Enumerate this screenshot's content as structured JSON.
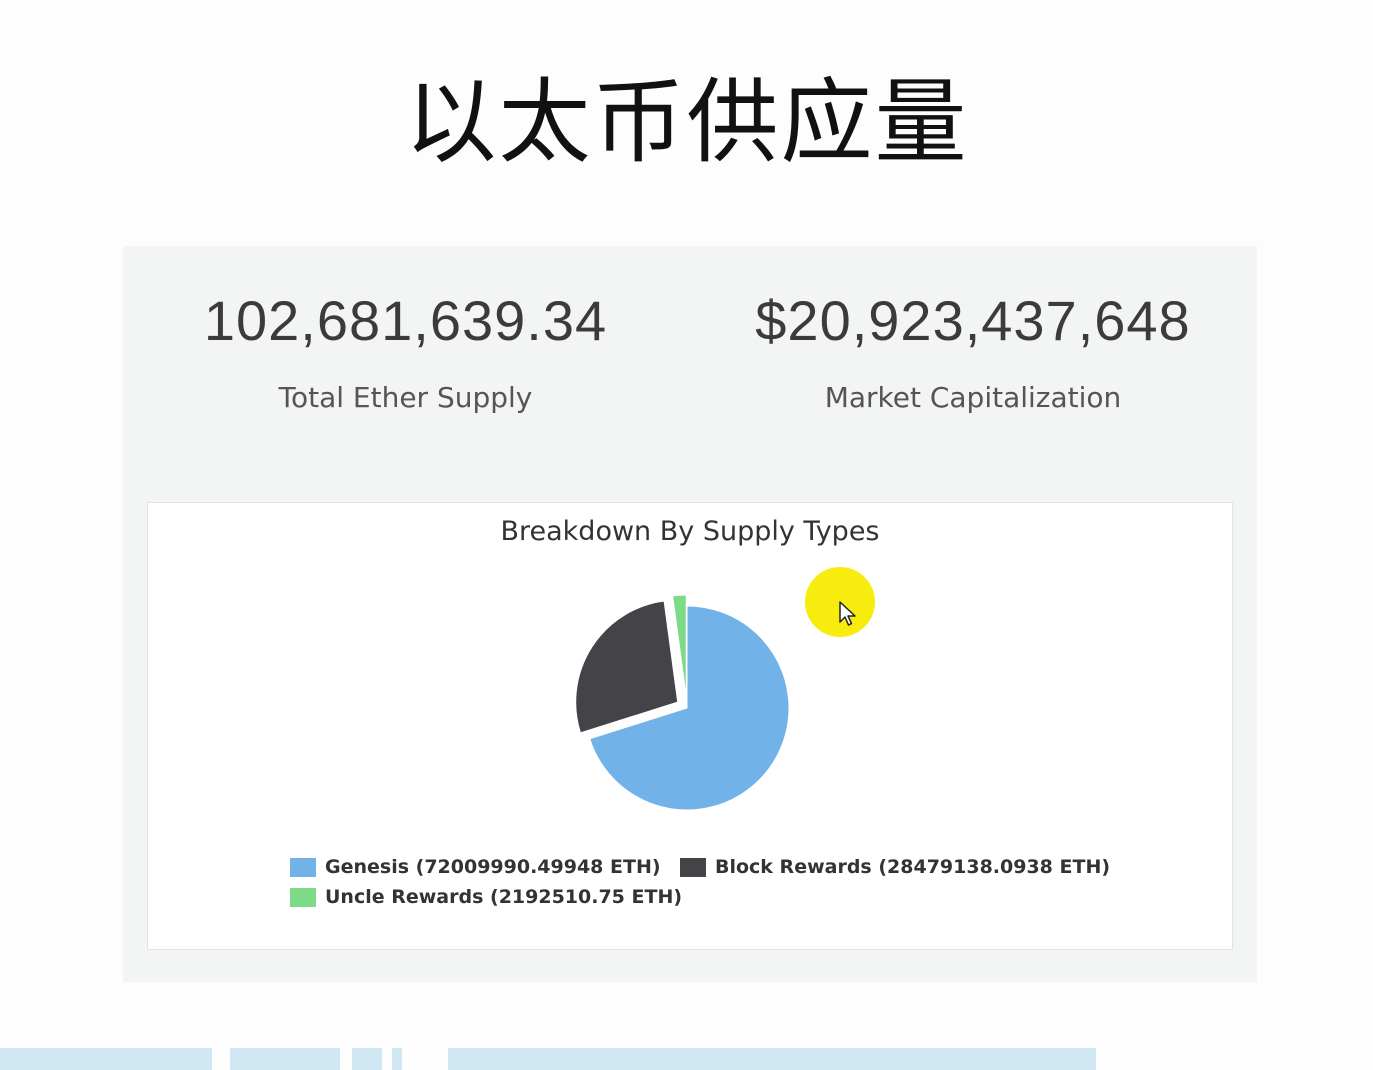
{
  "slide": {
    "title": "以太币供应量"
  },
  "stats": {
    "total_supply": {
      "value": "102,681,639.34",
      "label": "Total Ether Supply"
    },
    "market_cap": {
      "value": "$20,923,437,648",
      "label": "Market Capitalization"
    }
  },
  "colors": {
    "genesis": "#71b2e8",
    "block_rewards": "#434348",
    "uncle_rewards": "#7ddb87",
    "panel_bg": "#f3f4f4",
    "cursor_highlight": "#f7ec0e"
  },
  "chart_data": {
    "type": "pie",
    "title": "Breakdown By Supply Types",
    "slices": [
      {
        "name": "Genesis",
        "value": 72009990.49948,
        "color": "#71b2e8",
        "sliced": false
      },
      {
        "name": "Block Rewards",
        "value": 28479138.0938,
        "color": "#434348",
        "sliced": true
      },
      {
        "name": "Uncle Rewards",
        "value": 2192510.75,
        "color": "#7ddb87",
        "sliced": true
      }
    ],
    "legend": {
      "placement": "bottom",
      "items": [
        {
          "label": "Genesis (72009990.49948 ETH)",
          "color": "#71b2e8"
        },
        {
          "label": "Block Rewards (28479138.0938 ETH)",
          "color": "#434348"
        },
        {
          "label": "Uncle Rewards (2192510.75 ETH)",
          "color": "#7ddb87"
        }
      ]
    }
  }
}
